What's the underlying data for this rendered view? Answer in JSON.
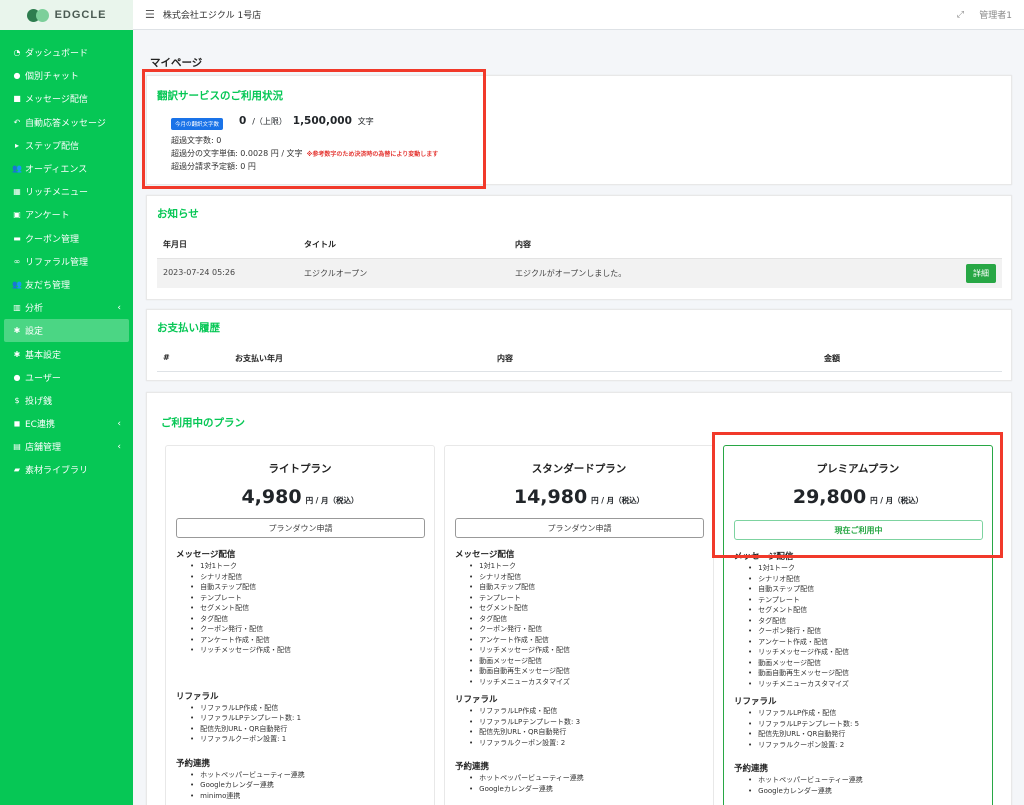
{
  "brand": {
    "name": "EDGCLE"
  },
  "header": {
    "store": "株式会社エジクル 1号店",
    "admin": "管理者1"
  },
  "sidebar": {
    "items": [
      {
        "icon": "◔",
        "label": "ダッシュボード"
      },
      {
        "icon": "●",
        "label": "個別チャット"
      },
      {
        "icon": "■",
        "label": "メッセージ配信"
      },
      {
        "icon": "↶",
        "label": "自動応答メッセージ"
      },
      {
        "icon": "▸",
        "label": "ステップ配信"
      },
      {
        "icon": "👥",
        "label": "オーディエンス"
      },
      {
        "icon": "▦",
        "label": "リッチメニュー"
      },
      {
        "icon": "▣",
        "label": "アンケート"
      },
      {
        "icon": "▬",
        "label": "クーポン管理"
      },
      {
        "icon": "∞",
        "label": "リファラル管理"
      },
      {
        "icon": "👥",
        "label": "友だち管理"
      },
      {
        "icon": "▥",
        "label": "分析",
        "chevron": "‹"
      },
      {
        "icon": "✱",
        "label": "設定",
        "active": true
      },
      {
        "icon": "✱",
        "label": "基本設定"
      },
      {
        "icon": "●",
        "label": "ユーザー"
      },
      {
        "icon": "$",
        "label": "投げ銭"
      },
      {
        "icon": "◼",
        "label": "EC連携",
        "chevron": "‹"
      },
      {
        "icon": "▤",
        "label": "店舗管理",
        "chevron": "‹"
      },
      {
        "icon": "▰",
        "label": "素材ライブラリ"
      }
    ]
  },
  "page": {
    "title": "マイページ"
  },
  "translation": {
    "title": "翻訳サービスのご利用状況",
    "badge": "今月の翻訳文字数",
    "used": "0",
    "limit_label": "/（上限）",
    "limit": "1,500,000",
    "unit": "文字",
    "overage_count": "超過文字数: 0",
    "overage_price": "超過分の文字単価: 0.0028 円 / 文字",
    "note": "※参考数字のため決済時の為替により変動します",
    "overage_bill": "超過分請求予定額: 0 円"
  },
  "notice": {
    "title": "お知らせ",
    "headers": [
      "年月日",
      "タイトル",
      "内容"
    ],
    "rows": [
      {
        "date": "2023-07-24 05:26",
        "title": "エジクルオープン",
        "content": "エジクルがオープンしました。",
        "button": "詳細"
      }
    ]
  },
  "payment": {
    "title": "お支払い履歴",
    "headers": [
      "#",
      "お支払い年月",
      "内容",
      "金額"
    ]
  },
  "plans": {
    "title": "ご利用中のプラン",
    "items": [
      {
        "name": "ライトプラン",
        "price": "4,980",
        "unit": "円 / 月（税込）",
        "button": "プランダウン申請",
        "sections": [
          {
            "title": "メッセージ配信",
            "features": [
              "1対1トーク",
              "シナリオ配信",
              "自動ステップ配信",
              "テンプレート",
              "セグメント配信",
              "タグ配信",
              "クーポン発行・配信",
              "アンケート作成・配信",
              "リッチメッセージ作成・配信"
            ]
          },
          {
            "title": "リファラル",
            "features": [
              "リファラルLP作成・配信",
              "リファラルLPテンプレート数: 1",
              "配信先別URL・QR自動発行",
              "リファラルクーポン設置: 1"
            ]
          },
          {
            "title": "予約連携",
            "features": [
              "ホットペッパービューティー連携",
              "Googleカレンダー連携",
              "minimo連携"
            ]
          }
        ]
      },
      {
        "name": "スタンダードプラン",
        "price": "14,980",
        "unit": "円 / 月（税込）",
        "button": "プランダウン申請",
        "sections": [
          {
            "title": "メッセージ配信",
            "features": [
              "1対1トーク",
              "シナリオ配信",
              "自動ステップ配信",
              "テンプレート",
              "セグメント配信",
              "タグ配信",
              "クーポン発行・配信",
              "アンケート作成・配信",
              "リッチメッセージ作成・配信",
              "動画メッセージ配信",
              "動画自動再生メッセージ配信",
              "リッチメニューカスタマイズ"
            ]
          },
          {
            "title": "リファラル",
            "features": [
              "リファラルLP作成・配信",
              "リファラルLPテンプレート数: 3",
              "配信先別URL・QR自動発行",
              "リファラルクーポン設置: 2"
            ]
          },
          {
            "title": "予約連携",
            "features": [
              "ホットペッパービューティー連携",
              "Googleカレンダー連携"
            ]
          }
        ]
      },
      {
        "name": "プレミアムプラン",
        "price": "29,800",
        "unit": "円 / 月（税込）",
        "button": "現在ご利用中",
        "current": true,
        "sections": [
          {
            "title": "メッセージ配信",
            "features": [
              "1対1トーク",
              "シナリオ配信",
              "自動ステップ配信",
              "テンプレート",
              "セグメント配信",
              "タグ配信",
              "クーポン発行・配信",
              "アンケート作成・配信",
              "リッチメッセージ作成・配信",
              "動画メッセージ配信",
              "動画自動再生メッセージ配信",
              "リッチメニューカスタマイズ"
            ]
          },
          {
            "title": "リファラル",
            "features": [
              "リファラルLP作成・配信",
              "リファラルLPテンプレート数: 5",
              "配信先別URL・QR自動発行",
              "リファラルクーポン設置: 2"
            ]
          },
          {
            "title": "予約連携",
            "features": [
              "ホットペッパービューティー連携",
              "Googleカレンダー連携"
            ]
          }
        ]
      }
    ]
  }
}
